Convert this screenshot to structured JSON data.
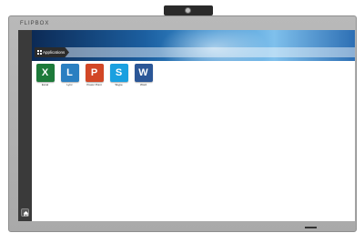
{
  "device": {
    "brand": "FLIPBOX"
  },
  "banner": {
    "tab_label": "Applications"
  },
  "apps": [
    {
      "label": "Excel",
      "icon": "excel-icon",
      "letter": "X",
      "color": "#1d7a3a"
    },
    {
      "label": "Lync",
      "icon": "lync-icon",
      "letter": "L",
      "color": "#2a7fc1"
    },
    {
      "label": "Power Point",
      "icon": "powerpoint-icon",
      "letter": "P",
      "color": "#d24726"
    },
    {
      "label": "Skype",
      "icon": "skype-icon",
      "letter": "S",
      "color": "#1aa0e0"
    },
    {
      "label": "Word",
      "icon": "word-icon",
      "letter": "W",
      "color": "#2b5797"
    }
  ]
}
